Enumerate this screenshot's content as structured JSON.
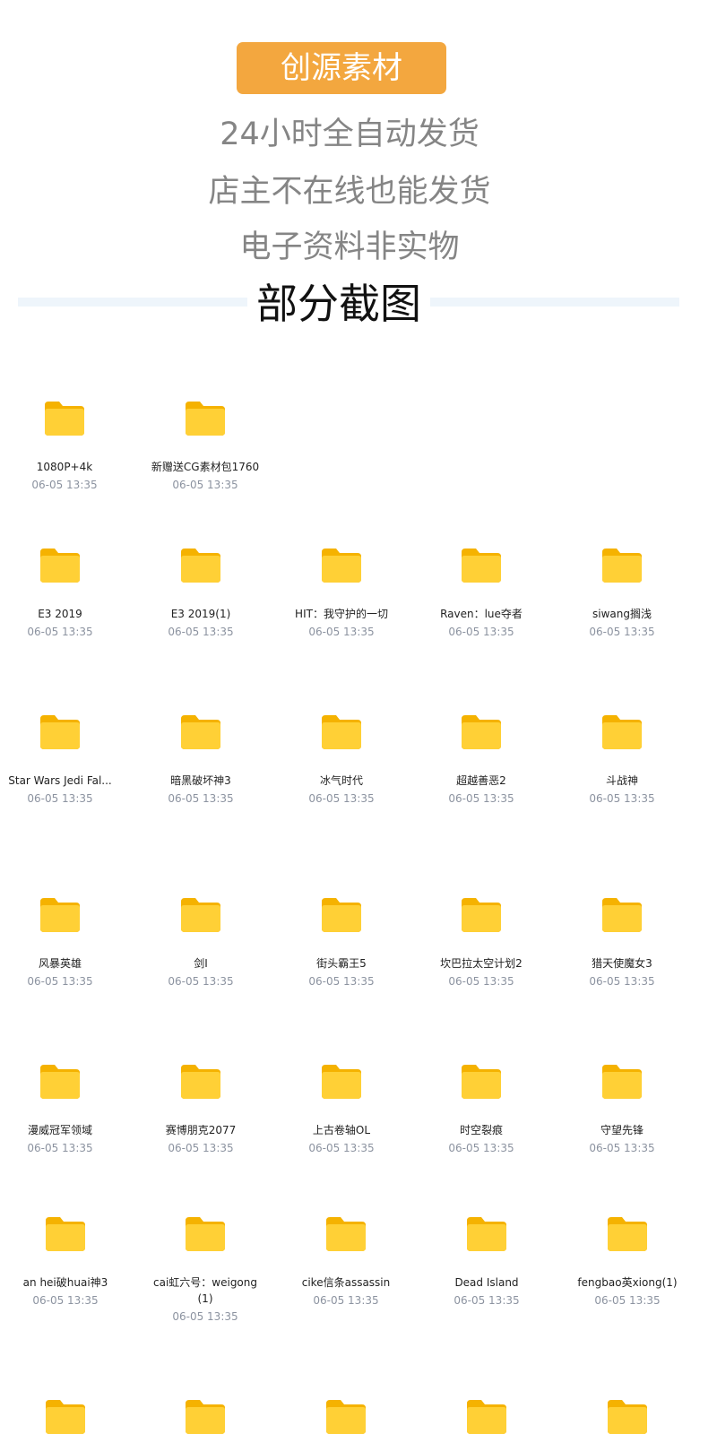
{
  "header": {
    "brand": "创源素材",
    "lines": [
      "24小时全自动发货",
      "店主不在线也能发货",
      "电子资料非实物"
    ],
    "section_title": "部分截图"
  },
  "colors": {
    "brand_badge": "#f3a73f",
    "folder_back": "#f7b500",
    "folder_front": "#ffcf33",
    "date_text": "#8c93a0"
  },
  "folders": [
    {
      "name": "1080P+4k",
      "date": "06-05 13:35"
    },
    {
      "name": "新赠送CG素材包1760",
      "date": "06-05 13:35"
    },
    {
      "name": "E3 2019",
      "date": "06-05 13:35"
    },
    {
      "name": "E3 2019(1)",
      "date": "06-05 13:35"
    },
    {
      "name": "HIT：我守护的一切",
      "date": "06-05 13:35"
    },
    {
      "name": "Raven：lue夺者",
      "date": "06-05 13:35"
    },
    {
      "name": "siwang搁浅",
      "date": "06-05 13:35"
    },
    {
      "name": "Star Wars Jedi Fal...",
      "date": "06-05 13:35"
    },
    {
      "name": "暗黑破坏神3",
      "date": "06-05 13:35"
    },
    {
      "name": "冰气时代",
      "date": "06-05 13:35"
    },
    {
      "name": "超越善恶2",
      "date": "06-05 13:35"
    },
    {
      "name": "斗战神",
      "date": "06-05 13:35"
    },
    {
      "name": "风暴英雄",
      "date": "06-05 13:35"
    },
    {
      "name": "剑I",
      "date": "06-05 13:35"
    },
    {
      "name": "街头霸王5",
      "date": "06-05 13:35"
    },
    {
      "name": "坎巴拉太空计划2",
      "date": "06-05 13:35"
    },
    {
      "name": "猎天使魔女3",
      "date": "06-05 13:35"
    },
    {
      "name": "漫威冠军领域",
      "date": "06-05 13:35"
    },
    {
      "name": "赛博朋克2077",
      "date": "06-05 13:35"
    },
    {
      "name": "上古卷轴OL",
      "date": "06-05 13:35"
    },
    {
      "name": "时空裂痕",
      "date": "06-05 13:35"
    },
    {
      "name": "守望先锋",
      "date": "06-05 13:35"
    },
    {
      "name": "an hei破huai神3",
      "date": "06-05 13:35"
    },
    {
      "name": "cai虹六号：weigong(1)",
      "date": "06-05 13:35"
    },
    {
      "name": "cike信条assassin",
      "date": "06-05 13:35"
    },
    {
      "name": "Dead Island",
      "date": "06-05 13:35"
    },
    {
      "name": "fengbao英xiong(1)",
      "date": "06-05 13:35"
    }
  ]
}
